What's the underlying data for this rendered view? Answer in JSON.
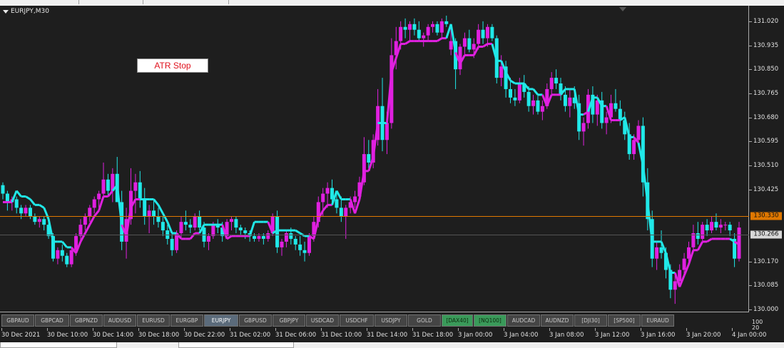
{
  "chart": {
    "symbol": "EURJPY,M30",
    "indicator_label": "ATR Stop",
    "current_bid_price": "130.266",
    "horizontal_level_price": "130.330",
    "colors": {
      "background": "#1e1e1e",
      "bull": "#e020e0",
      "bear": "#20e8e8",
      "level_line": "#e07800",
      "bid_line": "#555555"
    }
  },
  "price_axis": {
    "labels": [
      "131.020",
      "130.935",
      "130.850",
      "130.765",
      "130.680",
      "130.595",
      "130.510",
      "130.425",
      "130.170",
      "130.085",
      "130.000"
    ],
    "bottom_corner": [
      "100",
      "20"
    ]
  },
  "time_axis": {
    "labels": [
      "30 Dec 2021",
      "30 Dec 10:00",
      "30 Dec 14:00",
      "30 Dec 18:00",
      "30 Dec 22:00",
      "31 Dec 02:00",
      "31 Dec 06:00",
      "31 Dec 10:00",
      "31 Dec 14:00",
      "31 Dec 18:00",
      "3 Jan 00:00",
      "3 Jan 04:00",
      "3 Jan 08:00",
      "3 Jan 12:00",
      "3 Jan 16:00",
      "3 Jan 20:00",
      "4 Jan 00:00"
    ]
  },
  "symbols_bar": [
    {
      "label": "GBPAUD",
      "style": "normal"
    },
    {
      "label": "GBPCAD",
      "style": "normal"
    },
    {
      "label": "GBPNZD",
      "style": "normal"
    },
    {
      "label": "AUDUSD",
      "style": "normal"
    },
    {
      "label": "EURUSD",
      "style": "normal"
    },
    {
      "label": "EURGBP",
      "style": "normal"
    },
    {
      "label": "EURJPY",
      "style": "active"
    },
    {
      "label": "GBPUSD",
      "style": "normal"
    },
    {
      "label": "GBPJPY",
      "style": "normal"
    },
    {
      "label": "USDCAD",
      "style": "normal"
    },
    {
      "label": "USDCHF",
      "style": "normal"
    },
    {
      "label": "USDJPY",
      "style": "normal"
    },
    {
      "label": "GOLD",
      "style": "normal"
    },
    {
      "label": "[DAX40]",
      "style": "green"
    },
    {
      "label": "[NQ100]",
      "style": "green"
    },
    {
      "label": "AUDCAD",
      "style": "normal"
    },
    {
      "label": "AUDNZD",
      "style": "normal"
    },
    {
      "label": "[DJI30]",
      "style": "normal"
    },
    {
      "label": "[SP500]",
      "style": "normal"
    },
    {
      "label": "EURAUD",
      "style": "normal"
    }
  ],
  "chart_data": {
    "type": "candlestick",
    "ylim": [
      130.0,
      131.06
    ],
    "candles": [
      [
        130.44,
        130.45,
        130.39,
        130.41
      ],
      [
        130.41,
        130.42,
        130.35,
        130.38
      ],
      [
        130.38,
        130.4,
        130.35,
        130.39
      ],
      [
        130.39,
        130.4,
        130.34,
        130.36
      ],
      [
        130.36,
        130.37,
        130.32,
        130.34
      ],
      [
        130.34,
        130.37,
        130.33,
        130.36
      ],
      [
        130.36,
        130.37,
        130.32,
        130.33
      ],
      [
        130.33,
        130.34,
        130.3,
        130.31
      ],
      [
        130.31,
        130.33,
        130.29,
        130.32
      ],
      [
        130.32,
        130.33,
        130.28,
        130.3
      ],
      [
        130.3,
        130.31,
        130.25,
        130.26
      ],
      [
        130.26,
        130.27,
        130.17,
        130.18
      ],
      [
        130.18,
        130.22,
        130.16,
        130.21
      ],
      [
        130.21,
        130.23,
        130.17,
        130.19
      ],
      [
        130.19,
        130.2,
        130.15,
        130.16
      ],
      [
        130.16,
        130.22,
        130.15,
        130.21
      ],
      [
        130.21,
        130.27,
        130.19,
        130.26
      ],
      [
        130.26,
        130.32,
        130.24,
        130.3
      ],
      [
        130.3,
        130.34,
        130.28,
        130.33
      ],
      [
        130.33,
        130.37,
        130.31,
        130.36
      ],
      [
        130.36,
        130.4,
        130.34,
        130.39
      ],
      [
        130.39,
        130.42,
        130.36,
        130.41
      ],
      [
        130.41,
        130.52,
        130.4,
        130.46
      ],
      [
        130.46,
        130.48,
        130.4,
        130.42
      ],
      [
        130.42,
        130.5,
        130.38,
        130.48
      ],
      [
        130.48,
        130.54,
        130.43,
        130.38
      ],
      [
        130.38,
        130.42,
        130.21,
        130.24
      ],
      [
        130.24,
        130.36,
        130.18,
        130.32
      ],
      [
        130.32,
        130.5,
        130.3,
        130.42
      ],
      [
        130.42,
        130.48,
        130.34,
        130.45
      ],
      [
        130.45,
        130.49,
        130.36,
        130.39
      ],
      [
        130.39,
        130.43,
        130.3,
        130.33
      ],
      [
        130.33,
        130.37,
        130.27,
        130.35
      ],
      [
        130.35,
        130.39,
        130.3,
        130.33
      ],
      [
        130.33,
        130.36,
        130.29,
        130.31
      ],
      [
        130.31,
        130.33,
        130.26,
        130.28
      ],
      [
        130.28,
        130.3,
        130.23,
        130.25
      ],
      [
        130.25,
        130.27,
        130.19,
        130.21
      ],
      [
        130.21,
        130.28,
        130.2,
        130.27
      ],
      [
        130.27,
        130.33,
        130.25,
        130.31
      ],
      [
        130.31,
        130.35,
        130.28,
        130.3
      ],
      [
        130.3,
        130.32,
        130.27,
        130.29
      ],
      [
        130.29,
        130.34,
        130.28,
        130.33
      ],
      [
        130.33,
        130.35,
        130.28,
        130.29
      ],
      [
        130.29,
        130.31,
        130.22,
        130.24
      ],
      [
        130.24,
        130.27,
        130.21,
        130.26
      ],
      [
        130.26,
        130.31,
        130.25,
        130.3
      ],
      [
        130.3,
        130.32,
        130.27,
        130.29
      ],
      [
        130.29,
        130.31,
        130.24,
        130.26
      ],
      [
        130.26,
        130.32,
        130.25,
        130.31
      ],
      [
        130.31,
        130.33,
        130.28,
        130.32
      ],
      [
        130.32,
        130.33,
        130.27,
        130.29
      ],
      [
        130.29,
        130.3,
        130.26,
        130.28
      ],
      [
        130.28,
        130.29,
        130.25,
        130.27
      ],
      [
        130.27,
        130.28,
        130.24,
        130.26
      ],
      [
        130.26,
        130.27,
        130.24,
        130.25
      ],
      [
        130.25,
        130.27,
        130.24,
        130.26
      ],
      [
        130.26,
        130.27,
        130.23,
        130.25
      ],
      [
        130.25,
        130.28,
        130.24,
        130.27
      ],
      [
        130.27,
        130.34,
        130.26,
        130.33
      ],
      [
        130.33,
        130.35,
        130.2,
        130.22
      ],
      [
        130.22,
        130.25,
        130.19,
        130.24
      ],
      [
        130.24,
        130.28,
        130.22,
        130.27
      ],
      [
        130.27,
        130.29,
        130.23,
        130.25
      ],
      [
        130.25,
        130.26,
        130.21,
        130.23
      ],
      [
        130.23,
        130.26,
        130.19,
        130.21
      ],
      [
        130.21,
        130.24,
        130.17,
        130.2
      ],
      [
        130.2,
        130.27,
        130.19,
        130.26
      ],
      [
        130.26,
        130.33,
        130.24,
        130.31
      ],
      [
        130.31,
        130.4,
        130.29,
        130.38
      ],
      [
        130.38,
        130.43,
        130.33,
        130.41
      ],
      [
        130.41,
        130.45,
        130.36,
        130.43
      ],
      [
        130.43,
        130.46,
        130.37,
        130.39
      ],
      [
        130.39,
        130.42,
        130.34,
        130.36
      ],
      [
        130.36,
        130.4,
        130.31,
        130.33
      ],
      [
        130.33,
        130.37,
        130.25,
        130.36
      ],
      [
        130.36,
        130.4,
        130.34,
        130.38
      ],
      [
        130.38,
        130.42,
        130.36,
        130.4
      ],
      [
        130.4,
        130.47,
        130.39,
        130.45
      ],
      [
        130.45,
        130.61,
        130.44,
        130.55
      ],
      [
        130.55,
        130.6,
        130.5,
        130.52
      ],
      [
        130.52,
        130.62,
        130.5,
        130.6
      ],
      [
        130.6,
        130.78,
        130.58,
        130.72
      ],
      [
        130.72,
        130.82,
        130.56,
        130.6
      ],
      [
        130.6,
        130.7,
        130.55,
        130.66
      ],
      [
        130.66,
        130.96,
        130.64,
        130.9
      ],
      [
        130.9,
        131.0,
        130.85,
        130.95
      ],
      [
        130.95,
        131.02,
        130.92,
        131.0
      ],
      [
        131.0,
        131.03,
        130.96,
        130.99
      ],
      [
        130.99,
        131.02,
        130.95,
        131.01
      ],
      [
        131.01,
        131.03,
        130.97,
        130.99
      ],
      [
        130.99,
        131.02,
        130.95,
        130.96
      ],
      [
        130.96,
        130.98,
        130.93,
        130.97
      ],
      [
        130.97,
        131.01,
        130.95,
        131.0
      ],
      [
        131.0,
        131.02,
        130.98,
        131.01
      ],
      [
        131.01,
        131.02,
        130.97,
        130.98
      ],
      [
        130.98,
        131.03,
        130.96,
        131.02
      ],
      [
        131.02,
        131.04,
        131.0,
        131.01
      ],
      [
        130.92,
        131.0,
        130.9,
        130.95
      ],
      [
        130.95,
        130.96,
        130.78,
        130.85
      ],
      [
        130.85,
        130.94,
        130.83,
        130.93
      ],
      [
        130.93,
        130.98,
        130.9,
        130.96
      ],
      [
        130.96,
        130.99,
        130.91,
        130.92
      ],
      [
        130.92,
        130.96,
        130.89,
        130.94
      ],
      [
        130.94,
        131.01,
        130.92,
        130.99
      ],
      [
        130.99,
        131.02,
        130.94,
        130.96
      ],
      [
        130.96,
        131.01,
        130.93,
        131.0
      ],
      [
        131.0,
        131.01,
        130.95,
        130.96
      ],
      [
        130.96,
        130.97,
        130.8,
        130.82
      ],
      [
        130.82,
        130.9,
        130.79,
        130.86
      ],
      [
        130.86,
        130.88,
        130.75,
        130.78
      ],
      [
        130.78,
        130.82,
        130.73,
        130.75
      ],
      [
        130.75,
        130.78,
        130.72,
        130.74
      ],
      [
        130.74,
        130.82,
        130.73,
        130.8
      ],
      [
        130.8,
        130.83,
        130.75,
        130.77
      ],
      [
        130.77,
        130.79,
        130.7,
        130.72
      ],
      [
        130.72,
        130.76,
        130.69,
        130.74
      ],
      [
        130.74,
        130.76,
        130.69,
        130.7
      ],
      [
        130.7,
        130.74,
        130.67,
        130.72
      ],
      [
        130.72,
        130.8,
        130.71,
        130.78
      ],
      [
        130.78,
        130.84,
        130.76,
        130.82
      ],
      [
        130.82,
        130.85,
        130.78,
        130.8
      ],
      [
        130.8,
        130.82,
        130.74,
        130.76
      ],
      [
        130.76,
        130.79,
        130.7,
        130.72
      ],
      [
        130.72,
        130.78,
        130.68,
        130.75
      ],
      [
        130.75,
        130.79,
        130.71,
        130.73
      ],
      [
        130.73,
        130.76,
        130.6,
        130.63
      ],
      [
        130.63,
        130.68,
        130.58,
        130.66
      ],
      [
        130.66,
        130.78,
        130.64,
        130.76
      ],
      [
        130.76,
        130.79,
        130.66,
        130.69
      ],
      [
        130.69,
        130.76,
        130.65,
        130.74
      ],
      [
        130.74,
        130.77,
        130.64,
        130.66
      ],
      [
        130.66,
        130.7,
        130.62,
        130.68
      ],
      [
        130.68,
        130.76,
        130.66,
        130.73
      ],
      [
        130.73,
        130.78,
        130.7,
        130.71
      ],
      [
        130.71,
        130.74,
        130.65,
        130.67
      ],
      [
        130.67,
        130.7,
        130.6,
        130.62
      ],
      [
        130.62,
        130.66,
        130.53,
        130.55
      ],
      [
        130.55,
        130.62,
        130.53,
        130.6
      ],
      [
        130.6,
        130.67,
        130.58,
        130.65
      ],
      [
        130.65,
        130.68,
        130.4,
        130.45
      ],
      [
        130.45,
        130.5,
        130.28,
        130.32
      ],
      [
        130.32,
        130.35,
        130.15,
        130.18
      ],
      [
        130.18,
        130.24,
        130.14,
        130.22
      ],
      [
        130.22,
        130.28,
        130.18,
        130.2
      ],
      [
        130.2,
        130.22,
        130.11,
        130.14
      ],
      [
        130.14,
        130.16,
        130.04,
        130.07
      ],
      [
        130.07,
        130.12,
        130.02,
        130.1
      ],
      [
        130.1,
        130.16,
        130.08,
        130.14
      ],
      [
        130.14,
        130.2,
        130.12,
        130.18
      ],
      [
        130.18,
        130.24,
        130.16,
        130.22
      ],
      [
        130.22,
        130.3,
        130.2,
        130.27
      ],
      [
        130.27,
        130.31,
        130.23,
        130.25
      ],
      [
        130.25,
        130.31,
        130.24,
        130.3
      ],
      [
        130.3,
        130.32,
        130.26,
        130.28
      ],
      [
        130.28,
        130.33,
        130.27,
        130.31
      ],
      [
        130.31,
        130.34,
        130.28,
        130.29
      ],
      [
        130.29,
        130.32,
        130.27,
        130.3
      ],
      [
        130.3,
        130.31,
        130.28,
        130.3
      ],
      [
        130.3,
        130.31,
        130.26,
        130.28
      ],
      [
        130.25,
        130.27,
        130.15,
        130.18
      ],
      [
        130.18,
        130.31,
        130.17,
        130.29
      ]
    ]
  }
}
